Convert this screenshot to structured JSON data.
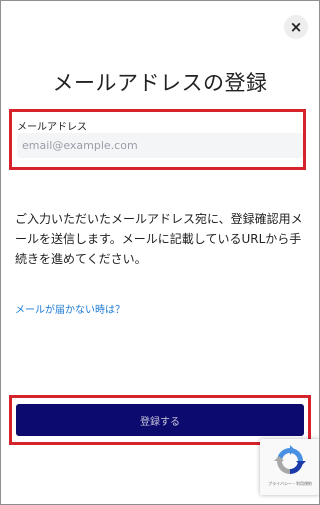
{
  "modal": {
    "close_symbol": "×",
    "title": "メールアドレスの登録"
  },
  "email": {
    "label": "メールアドレス",
    "placeholder": "email@example.com",
    "value": ""
  },
  "description": "ご入力いただいたメールアドレス宛に、登録確認用メールを送信します。メールに記載しているURLから手続きを進めてください。",
  "help_link": "メールが届かない時は？",
  "submit_label": "登録する",
  "recaptcha": {
    "icon": "recaptcha-icon",
    "terms": "プライバシー・利用規約"
  },
  "colors": {
    "highlight_border": "#d6222a",
    "primary_button": "#0d0a6e",
    "link": "#1a7ad6"
  }
}
